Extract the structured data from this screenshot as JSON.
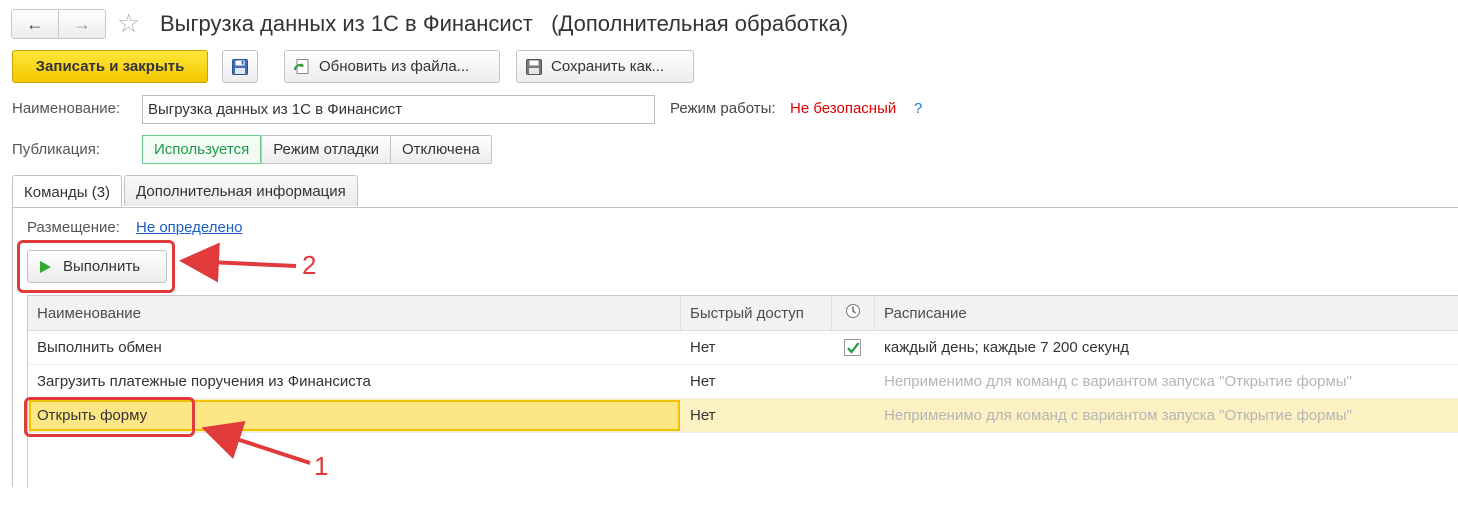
{
  "window": {
    "title": "Выгрузка данных из 1С в Финансист   (Дополнительная обработка)"
  },
  "nav": {
    "back_icon": "←",
    "forward_icon": "→",
    "star_icon": "☆"
  },
  "toolbar": {
    "save_close_label": "Записать и закрыть",
    "refresh_label": "Обновить из файла...",
    "save_as_label": "Сохранить как..."
  },
  "form": {
    "name_label": "Наименование:",
    "name_value": "Выгрузка данных из 1С в Финансист",
    "mode_label": "Режим работы:",
    "mode_value": "Не безопасный",
    "help": "?",
    "publication_label": "Публикация:",
    "publication_options": [
      "Используется",
      "Режим отладки",
      "Отключена"
    ],
    "publication_selected": "Используется"
  },
  "tabs": [
    {
      "label": "Команды (3)",
      "active": true
    },
    {
      "label": "Дополнительная информация",
      "active": false
    }
  ],
  "commands": {
    "placement_label": "Размещение:",
    "placement_value": "Не определено",
    "execute_label": "Выполнить",
    "columns": {
      "name": "Наименование",
      "quick_access": "Быстрый доступ",
      "schedule": "Расписание"
    },
    "rows": [
      {
        "name": "Выполнить обмен",
        "quick_access": "Нет",
        "scheduled": true,
        "schedule": "каждый день; каждые 7 200 секунд"
      },
      {
        "name": "Загрузить платежные поручения из Финансиста",
        "quick_access": "Нет",
        "scheduled": false,
        "schedule": "Неприменимо для команд с вариантом запуска \"Открытие формы\""
      },
      {
        "name": "Открыть форму",
        "quick_access": "Нет",
        "scheduled": false,
        "schedule": "Неприменимо для команд с вариантом запуска \"Открытие формы\"",
        "selected": true
      }
    ]
  },
  "annotations": {
    "marker_1": "1",
    "marker_2": "2"
  },
  "colors": {
    "accent_yellow": "#f3c800",
    "annotation_red": "#e03a3a",
    "link_blue": "#1a5ec4",
    "warning_red": "#e00000"
  }
}
